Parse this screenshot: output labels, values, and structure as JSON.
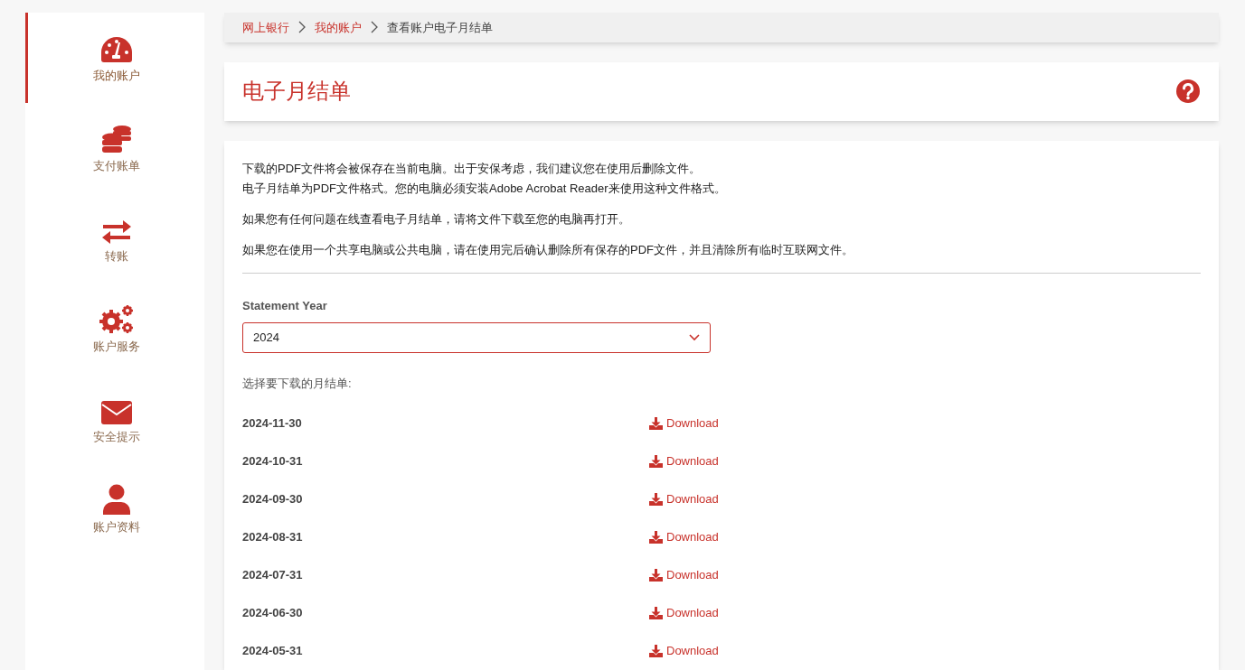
{
  "sidebar": {
    "items": [
      {
        "label": "我的账户",
        "selected": true
      },
      {
        "label": "支付账单",
        "selected": false
      },
      {
        "label": "转账",
        "selected": false
      },
      {
        "label": "账户服务",
        "selected": false
      },
      {
        "label": "安全提示",
        "selected": false
      },
      {
        "label": "账户资料",
        "selected": false
      }
    ]
  },
  "breadcrumb": [
    {
      "label": "网上银行",
      "kind": "link"
    },
    {
      "label": "我的账户",
      "kind": "link"
    },
    {
      "label": "查看账户电子月结单",
      "kind": "current"
    }
  ],
  "page_title": "电子月结单",
  "notes": [
    {
      "lines": [
        "下载的PDF文件将会被保存在当前电脑。出于安保考虑，我们建议您在使用后删除文件。",
        "电子月结单为PDF文件格式。您的电脑必须安装Adobe Acrobat Reader来使用这种文件格式。"
      ]
    },
    {
      "lines": [
        "如果您有任何问题在线查看电子月结单，请将文件下载至您的电脑再打开。"
      ]
    },
    {
      "lines": [
        "如果您在使用一个共享电脑或公共电脑，请在使用完后确认删除所有保存的PDF文件，并且清除所有临时互联网文件。"
      ]
    }
  ],
  "year_select": {
    "label": "Statement Year",
    "value": "2024"
  },
  "statements_label": "选择要下载的月结单:",
  "statements": [
    {
      "date": "2024-11-30",
      "action": "Download"
    },
    {
      "date": "2024-10-31",
      "action": "Download"
    },
    {
      "date": "2024-09-30",
      "action": "Download"
    },
    {
      "date": "2024-08-31",
      "action": "Download"
    },
    {
      "date": "2024-07-31",
      "action": "Download"
    },
    {
      "date": "2024-06-30",
      "action": "Download"
    },
    {
      "date": "2024-05-31",
      "action": "Download"
    }
  ]
}
